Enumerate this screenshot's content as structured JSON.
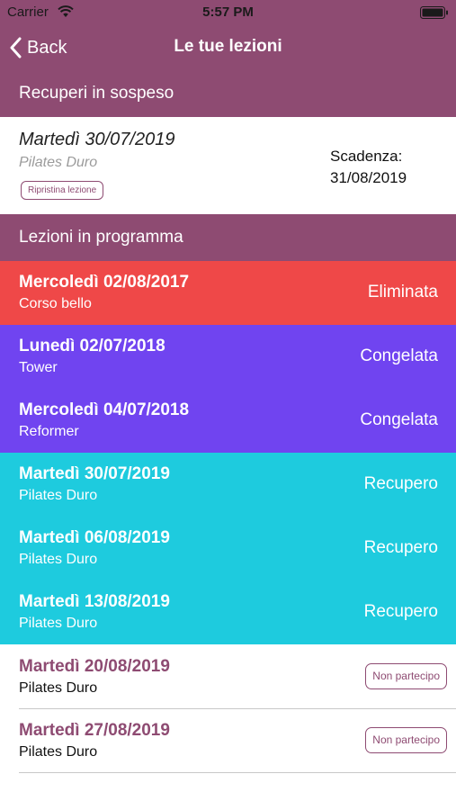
{
  "status_bar": {
    "carrier": "Carrier",
    "time": "5:57 PM",
    "wifi_icon": "wifi-icon",
    "battery_icon": "battery-icon"
  },
  "nav": {
    "back_label": "Back",
    "back_icon": "chevron-left-icon",
    "title": "Le tue lezioni"
  },
  "colors": {
    "header": "#8e4b72",
    "deleted": "#ef4848",
    "frozen": "#7044f0",
    "recovery": "#1ecbde",
    "accent": "#8e4b72"
  },
  "pending_section": {
    "title": "Recuperi in sospeso",
    "items": [
      {
        "date": "Martedì 30/07/2019",
        "course": "Pilates Duro",
        "action_label": "Ripristina lezione",
        "deadline_label": "Scadenza:",
        "deadline_date": "31/08/2019"
      }
    ]
  },
  "scheduled_section": {
    "title": "Lezioni in programma",
    "lessons": [
      {
        "date": "Mercoledì 02/08/2017",
        "course": "Corso bello",
        "status": "Eliminata"
      },
      {
        "date": "Lunedì 02/07/2018",
        "course": "Tower",
        "status": "Congelata"
      },
      {
        "date": "Mercoledì 04/07/2018",
        "course": "Reformer",
        "status": "Congelata"
      },
      {
        "date": "Martedì 30/07/2019",
        "course": "Pilates Duro",
        "status": "Recupero"
      },
      {
        "date": "Martedì 06/08/2019",
        "course": "Pilates Duro",
        "status": "Recupero"
      },
      {
        "date": "Martedì 13/08/2019",
        "course": "Pilates Duro",
        "status": "Recupero"
      },
      {
        "date": "Martedì 20/08/2019",
        "course": "Pilates Duro",
        "action_label": "Non partecipo"
      },
      {
        "date": "Martedì 27/08/2019",
        "course": "Pilates Duro",
        "action_label": "Non partecipo"
      }
    ]
  }
}
